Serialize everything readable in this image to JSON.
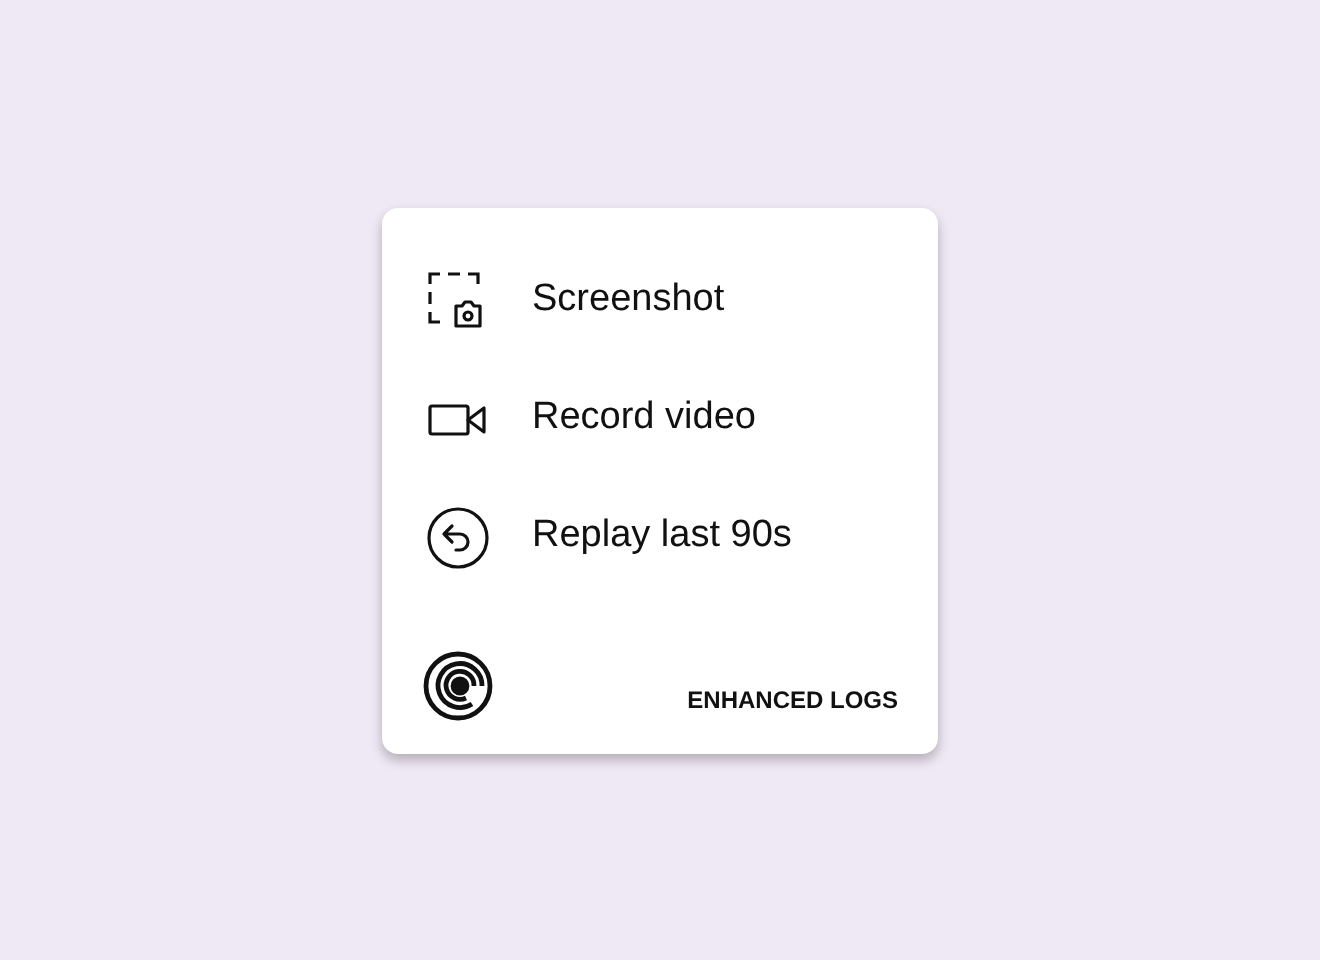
{
  "menu": {
    "items": [
      {
        "kind": "screenshot",
        "label": "Screenshot"
      },
      {
        "kind": "video",
        "label": "Record video"
      },
      {
        "kind": "replay",
        "label": "Replay last 90s"
      }
    ]
  },
  "footer": {
    "link": "ENHANCED LOGS"
  }
}
